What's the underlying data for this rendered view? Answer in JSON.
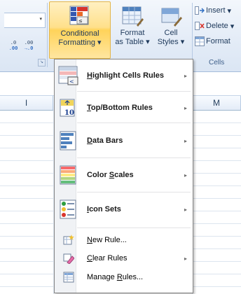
{
  "ribbon": {
    "conditional_formatting": {
      "line1": "Conditional",
      "line2": "Formatting"
    },
    "format_as_table": {
      "line1": "Format",
      "line2": "as Table"
    },
    "cell_styles": {
      "line1": "Cell",
      "line2": "Styles"
    },
    "cells_group": {
      "insert": "Insert",
      "delete": "Delete",
      "format": "Format",
      "label": "Cells"
    },
    "number_group": {
      "increase_decimal": {
        "top": ".0",
        "bottom": ".00"
      },
      "decrease_decimal": {
        "top": ".00",
        "bottom": "→.0"
      }
    },
    "dropdown_arrow": "▾"
  },
  "sheet": {
    "columns": [
      "I",
      "M"
    ]
  },
  "menu": {
    "items": [
      {
        "label": "Highlight Cells Rules",
        "accel": "H",
        "icon": "highlight-cells-icon",
        "submenu": true
      },
      {
        "label": "Top/Bottom Rules",
        "accel": "T",
        "icon": "top-bottom-icon",
        "submenu": true
      },
      {
        "label": "Data Bars",
        "accel": "D",
        "icon": "data-bars-icon",
        "submenu": true
      },
      {
        "label": "Color Scales",
        "accel": "S",
        "icon": "color-scales-icon",
        "submenu": true
      },
      {
        "label": "Icon Sets",
        "accel": "I",
        "icon": "icon-sets-icon",
        "submenu": true
      },
      {
        "label": "New Rule...",
        "accel": "N",
        "icon": "new-rule-icon",
        "submenu": false
      },
      {
        "label": "Clear Rules",
        "accel": "C",
        "icon": "clear-rules-icon",
        "submenu": true
      },
      {
        "label": "Manage Rules...",
        "accel": "R",
        "icon": "manage-rules-icon",
        "submenu": false
      }
    ],
    "submenu_arrow": "▸"
  },
  "colors": {
    "active_button": "#ffe08b",
    "ribbon_bg": "#dbe6f4",
    "menu_border": "#868686"
  }
}
